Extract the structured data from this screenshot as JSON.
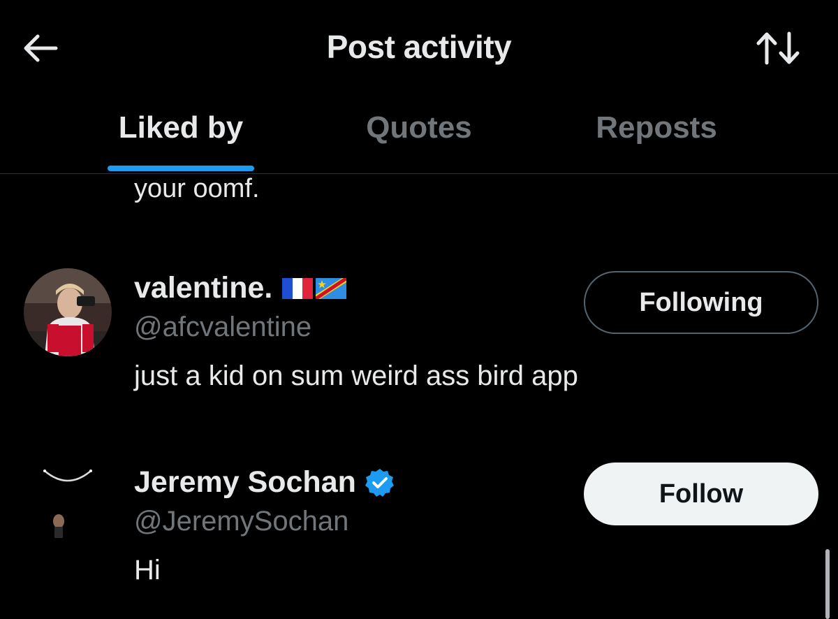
{
  "header": {
    "title": "Post activity",
    "back_icon": "arrow-left-icon",
    "sort_icon": "sort-arrows-icon"
  },
  "tabs": [
    {
      "label": "Liked by",
      "active": true
    },
    {
      "label": "Quotes",
      "active": false
    },
    {
      "label": "Reposts",
      "active": false
    }
  ],
  "list": {
    "clipped_bio": "your oomf.",
    "users": [
      {
        "name": "valentine.",
        "flags": [
          "france-flag",
          "dr-congo-flag"
        ],
        "verified": false,
        "handle": "@afcvalentine",
        "bio": "just a kid on sum weird ass bird app",
        "button_label": "Following"
      },
      {
        "name": "Jeremy Sochan",
        "flags": [],
        "verified": true,
        "handle": "@JeremySochan",
        "bio": "Hi",
        "button_label": "Follow"
      }
    ]
  },
  "colors": {
    "background": "#000000",
    "accent": "#1d9bf0",
    "text_primary": "#e7e9ea",
    "text_secondary": "#71767b"
  }
}
